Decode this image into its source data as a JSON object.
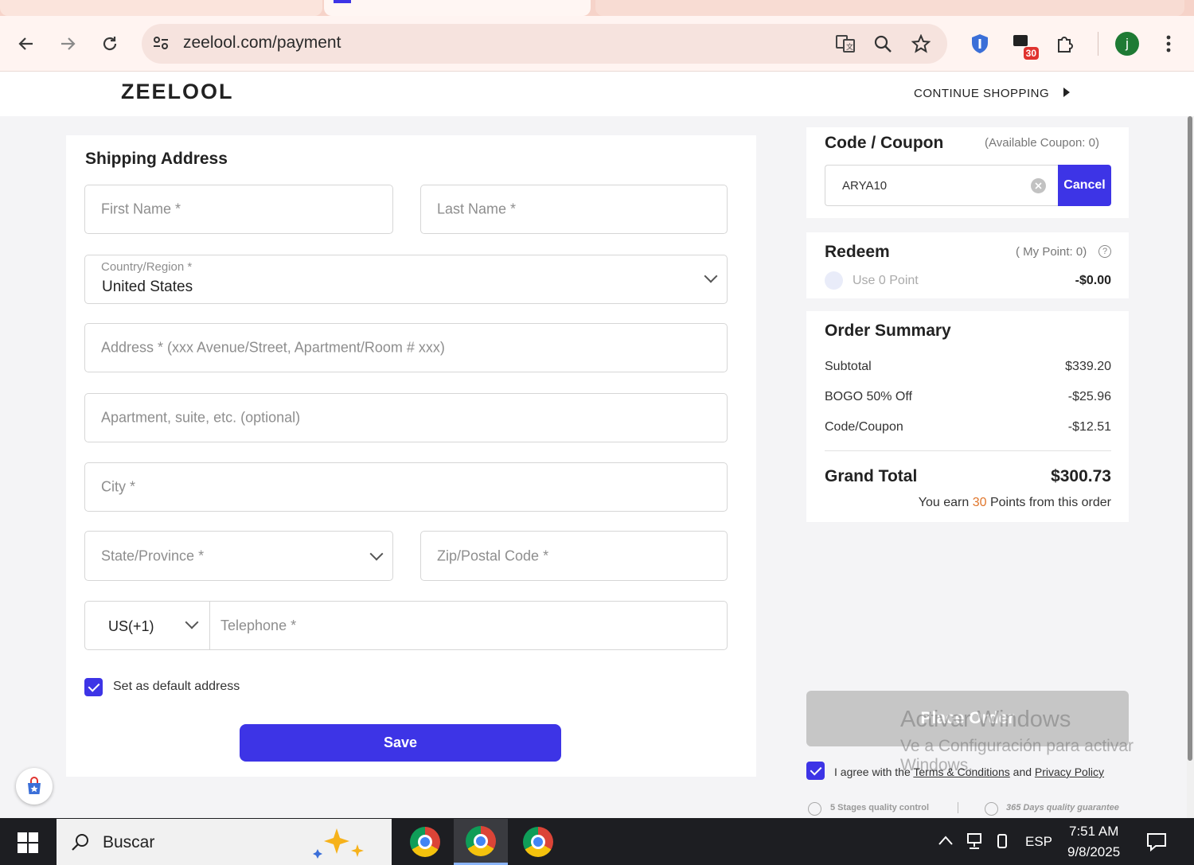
{
  "browser": {
    "url": "zeelool.com/payment",
    "ext_badge": "30",
    "profile_initial": "j"
  },
  "header": {
    "logo": "ZEELOOL",
    "continue_shopping": "CONTINUE SHOPPING"
  },
  "shipping": {
    "title": "Shipping Address",
    "first_name_ph": "First Name *",
    "last_name_ph": "Last Name *",
    "country_label": "Country/Region *",
    "country_value": "United States",
    "address_ph": "Address * (xxx Avenue/Street, Apartment/Room # xxx)",
    "apartment_ph": "Apartment, suite, etc. (optional)",
    "city_ph": "City *",
    "state_ph": "State/Province *",
    "zip_ph": "Zip/Postal Code *",
    "phone_code": "US(+1)",
    "telephone_ph": "Telephone *",
    "default_label": "Set as default address",
    "save_label": "Save"
  },
  "coupon": {
    "title": "Code / Coupon",
    "available": "(Available Coupon: 0)",
    "code_value": "ARYA10",
    "cancel_label": "Cancel"
  },
  "redeem": {
    "title": "Redeem",
    "my_point": "( My Point: 0)",
    "use_label": "Use 0 Point",
    "amount": "-$0.00"
  },
  "summary": {
    "title": "Order Summary",
    "lines": [
      {
        "label": "Subtotal",
        "value": "$339.20"
      },
      {
        "label": "BOGO 50% Off",
        "value": "-$25.96"
      },
      {
        "label": "Code/Coupon",
        "value": "-$12.51"
      }
    ],
    "grand_label": "Grand Total",
    "grand_value": "$300.73",
    "earn_prefix": "You earn",
    "earn_points": "30",
    "earn_suffix": "Points from this order"
  },
  "place_order": "Place Order",
  "terms": {
    "prefix": "I agree with the",
    "terms_link": "Terms & Conditions",
    "and": "and",
    "privacy_link": "Privacy Policy"
  },
  "badges": {
    "quality": "5 Stages quality control",
    "guarantee": "365 Days quality guarantee"
  },
  "windows_watermark": {
    "line1": "Activar Windows",
    "line2": "Ve a Configuración para activar Windows."
  },
  "taskbar": {
    "search": "Buscar",
    "lang": "ESP",
    "time": "7:51 AM",
    "date": "9/8/2025"
  },
  "colors": {
    "accent": "#3d34e6",
    "points": "#e0762c"
  }
}
